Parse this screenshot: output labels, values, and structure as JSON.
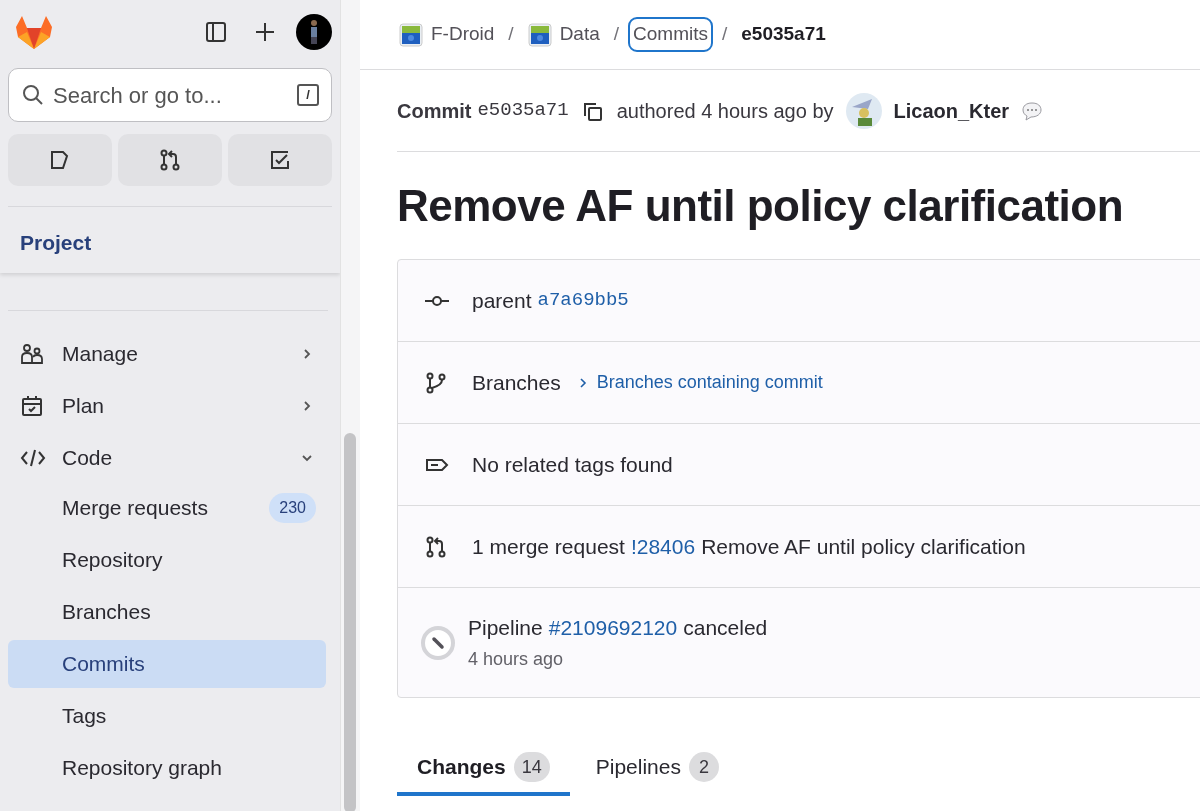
{
  "sidebar": {
    "search": {
      "placeholder": "Search or go to...",
      "shortcut": "/"
    },
    "section": "Project",
    "nav": [
      {
        "label": "Manage",
        "kind": "users",
        "expanded": false
      },
      {
        "label": "Plan",
        "kind": "calendar",
        "expanded": false
      },
      {
        "label": "Code",
        "kind": "code",
        "expanded": true,
        "children": [
          {
            "label": "Merge requests",
            "badge": "230",
            "selected": false
          },
          {
            "label": "Repository",
            "selected": false
          },
          {
            "label": "Branches",
            "selected": false
          },
          {
            "label": "Commits",
            "selected": true
          },
          {
            "label": "Tags",
            "selected": false
          },
          {
            "label": "Repository graph",
            "selected": false
          }
        ]
      }
    ]
  },
  "breadcrumbs": [
    {
      "label": "F-Droid",
      "kind": "project",
      "focused": false
    },
    {
      "label": "Data",
      "kind": "project",
      "focused": false,
      "separator": "/"
    },
    {
      "label": "Commits",
      "kind": "link",
      "focused": true,
      "separator": "/"
    },
    {
      "label": "e5035a71",
      "kind": "current",
      "focused": false,
      "separator": "/"
    }
  ],
  "commit_header": {
    "label": "Commit",
    "sha": "e5035a71",
    "authored": "authored 4 hours ago by",
    "author": "Licaon_Kter"
  },
  "title": "Remove AF until policy clarification",
  "info_rows": [
    {
      "kind": "parent",
      "text": "parent",
      "link": "a7a69bb5"
    },
    {
      "kind": "branches",
      "text": "Branches",
      "link": "Branches containing commit"
    },
    {
      "kind": "tags",
      "text": "No related tags found"
    },
    {
      "kind": "merge_request",
      "text": "1 merge request",
      "link": "!28406",
      "after": "Remove AF until policy clarification"
    },
    {
      "kind": "pipeline",
      "text": "Pipeline",
      "link": "#2109692120",
      "after": "canceled",
      "time": "4 hours ago"
    }
  ],
  "tabs": [
    {
      "label": "Changes",
      "count": "14",
      "selected": true
    },
    {
      "label": "Pipelines",
      "count": "2",
      "selected": false
    }
  ]
}
